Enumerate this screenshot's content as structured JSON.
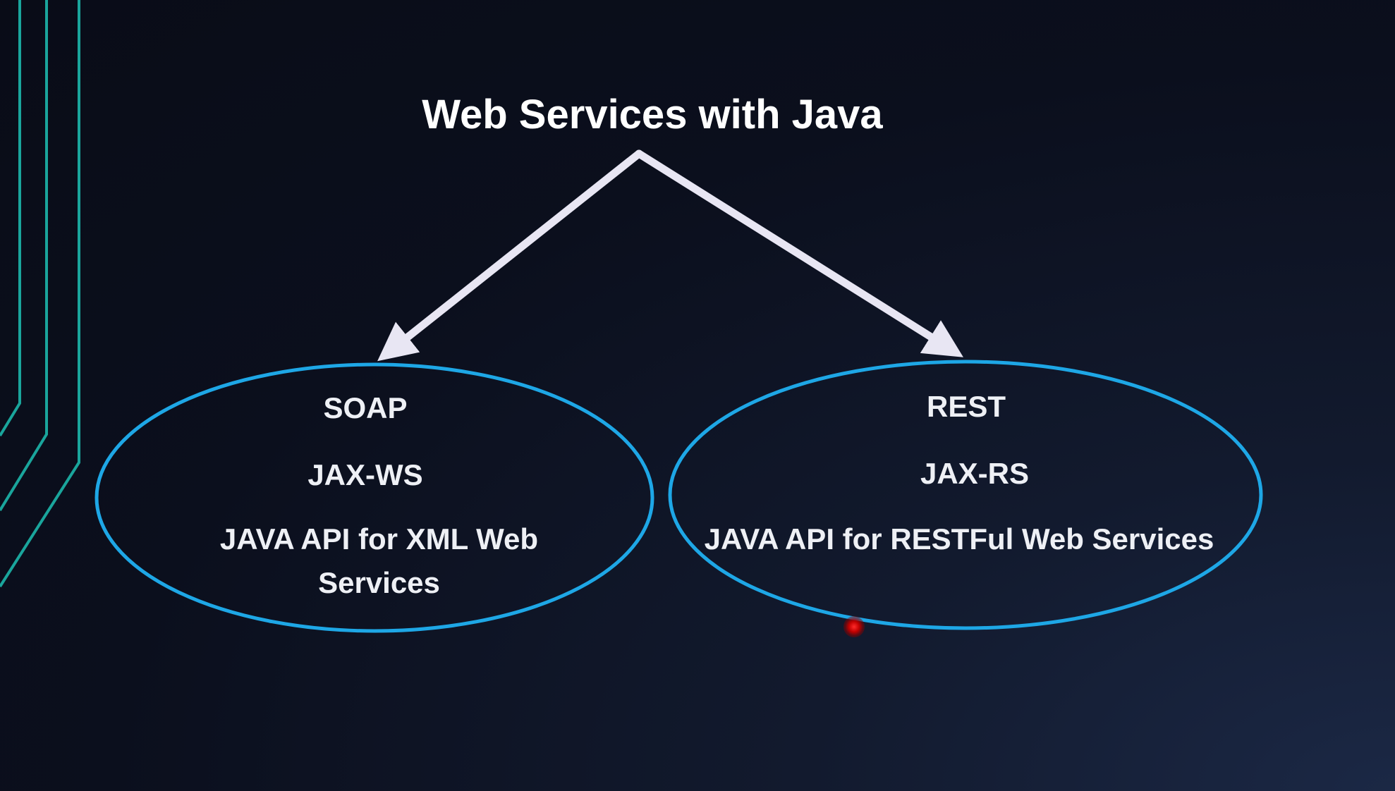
{
  "diagram": {
    "title": "Web Services with Java",
    "nodes": [
      {
        "name": "SOAP",
        "api": "JAX-WS",
        "description": "JAVA API for XML Web Services"
      },
      {
        "name": "REST",
        "api": "JAX-RS",
        "description": "JAVA API for RESTFul Web Services"
      }
    ],
    "edges": [
      {
        "from": "Web Services with Java",
        "to": "SOAP"
      },
      {
        "from": "Web Services with Java",
        "to": "REST"
      }
    ]
  },
  "colors": {
    "background": "#0b0f1d",
    "ellipse_stroke": "#1ea7e6",
    "arrow": "#e8e6f3",
    "accent_lines": "#1aa59c",
    "text": "#ffffff",
    "pointer": "#ff2a2a"
  },
  "icons": {
    "pointer": "laser-pointer-icon"
  }
}
